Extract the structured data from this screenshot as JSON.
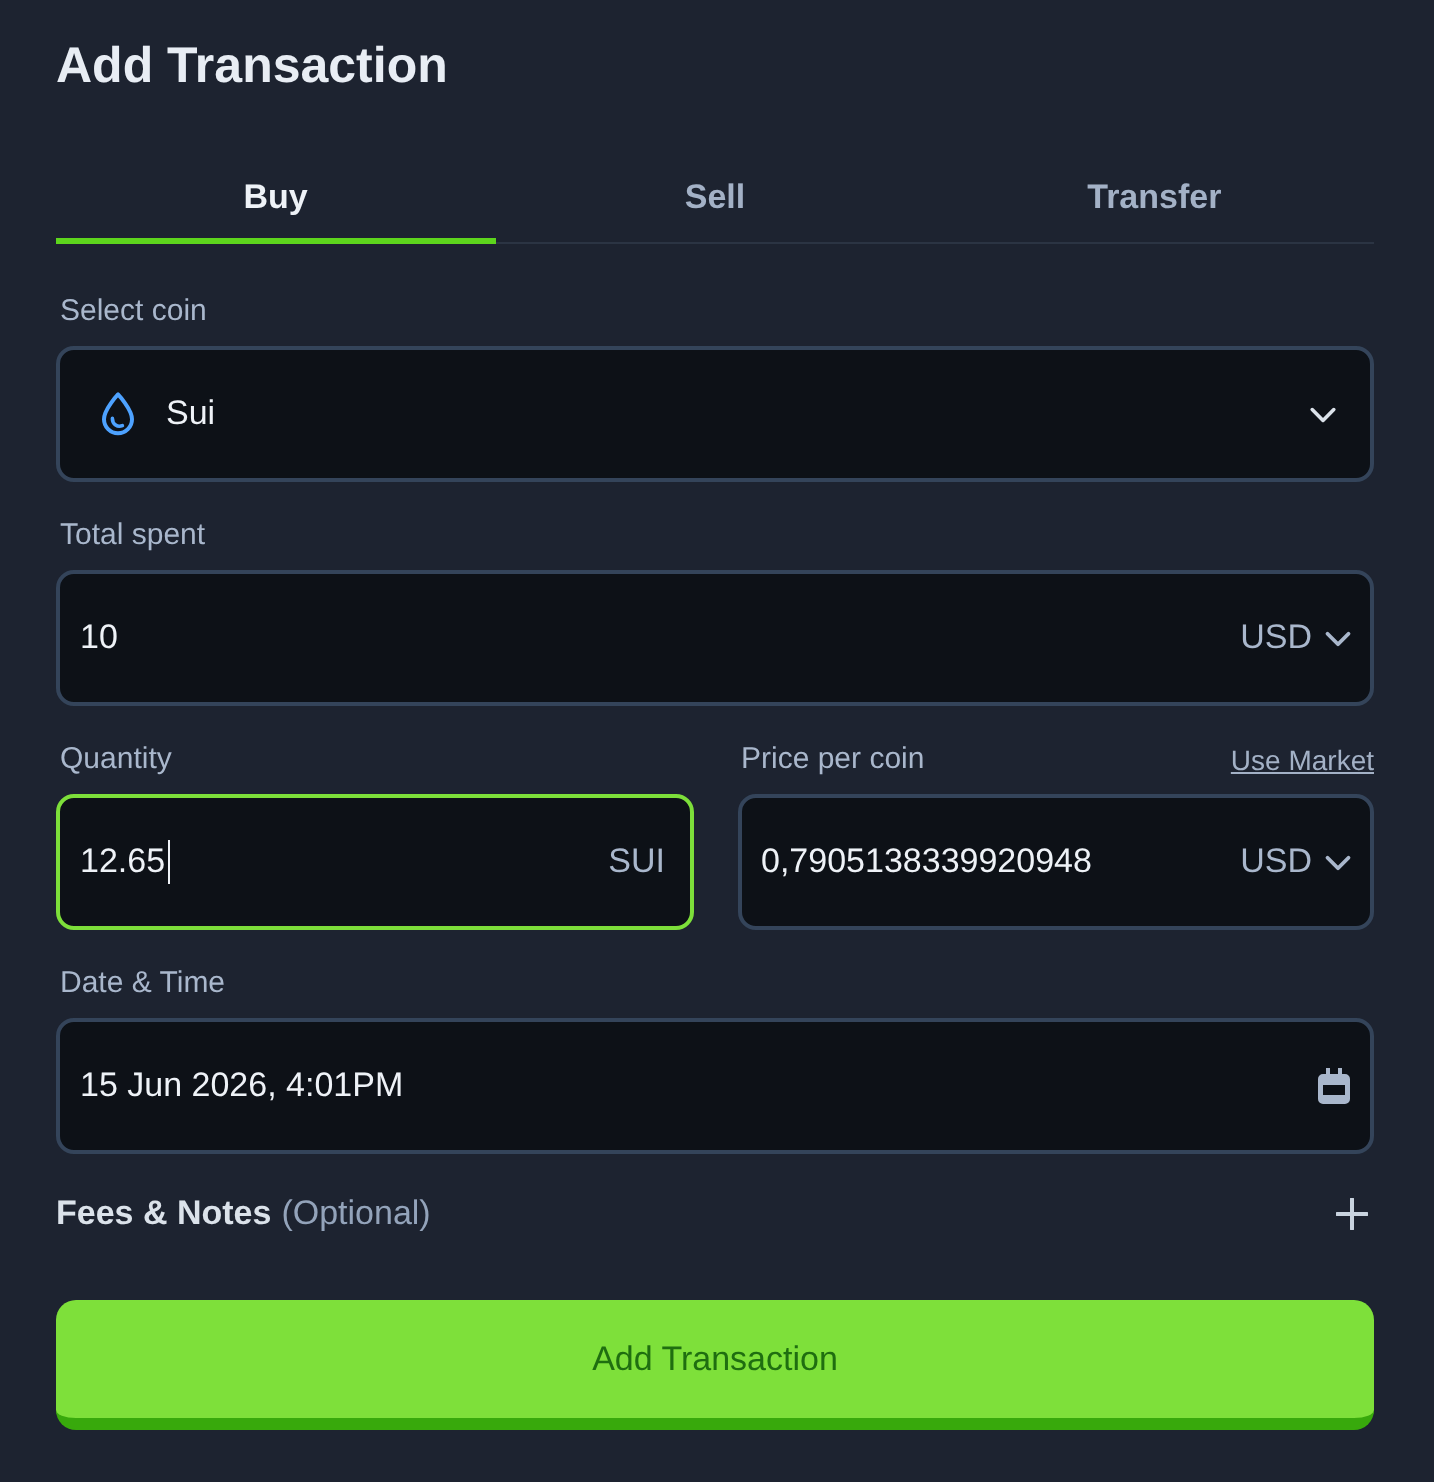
{
  "title": "Add Transaction",
  "tabs": [
    {
      "label": "Buy",
      "selected": true
    },
    {
      "label": "Sell",
      "selected": false
    },
    {
      "label": "Transfer",
      "selected": false
    }
  ],
  "coin": {
    "label": "Select coin",
    "value": "Sui",
    "focused": false
  },
  "total_spent": {
    "label": "Total spent",
    "value": "10",
    "unit": "USD",
    "unit_menu": true,
    "focused": false
  },
  "quantity": {
    "label": "Quantity",
    "value": "12.65",
    "unit": "SUI",
    "unit_menu": false,
    "focused": true
  },
  "price": {
    "label": "Price per coin",
    "link": "Use Market",
    "value": "0,7905138339920948",
    "unit": "USD",
    "unit_menu": true,
    "focused": false
  },
  "date_time": {
    "label": "Date & Time",
    "value": "15 Jun 2026, 4:01PM",
    "focused": false
  },
  "fees": {
    "label": "Fees & Notes",
    "hint": "(Optional)",
    "expanded": false
  },
  "submit": {
    "label": "Add Transaction"
  }
}
